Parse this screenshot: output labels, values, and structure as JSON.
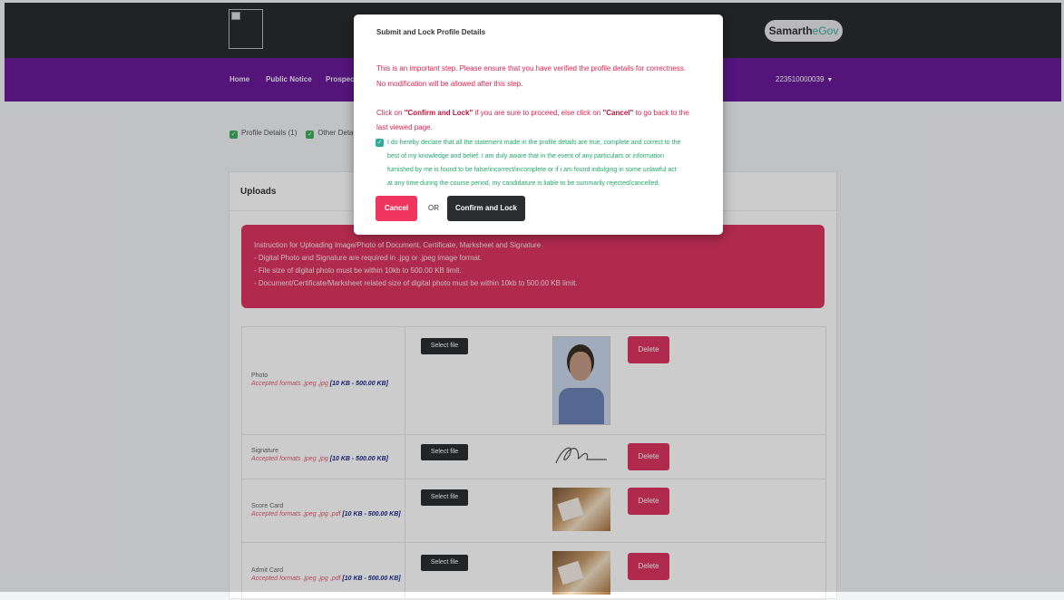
{
  "header": {
    "brand_main": "Samarth",
    "brand_sub": "eGov"
  },
  "nav": {
    "home": "Home",
    "public_notice": "Public Notice",
    "prospectus": "Prospect",
    "user_id": "223510000039"
  },
  "progress": {
    "profile_details": "Profile Details (1)",
    "other_details": "Other Deta"
  },
  "uploads": {
    "title": "Uploads",
    "instructions": [
      "Instruction for Uploading Image/Photo of Document, Certificate, Marksheet and Signature",
      "- Digital Photo and Signature are required in .jpg or .jpeg image format.",
      "- File size of digital photo must be within 10kb to 500.00 KB limit.",
      "- Document/Certificate/Marksheet related size of digital photo must be within 10kb to 500.00 KB limit."
    ],
    "rows": [
      {
        "label": "Photo",
        "formats": "Accepted formats .jpeg ,jpg",
        "size": "[10 KB - 500.00 KB]",
        "select": "Select file",
        "delete": "Delete"
      },
      {
        "label": "Signature",
        "formats": "Accepted formats .jpeg ,jpg",
        "size": "[10 KB - 500.00 KB]",
        "select": "Select file",
        "delete": "Delete"
      },
      {
        "label": "Score Card",
        "formats": "Accepted formats .jpeg ,jpg ,pdf",
        "size": "[10 KB - 500.00 KB]",
        "select": "Select file",
        "delete": "Delete"
      },
      {
        "label": "Admit Card",
        "formats": "Accepted formats .jpeg ,jpg ,pdf",
        "size": "[10 KB - 500.00 KB]",
        "select": "Select file",
        "delete": "Delete"
      }
    ]
  },
  "modal": {
    "title": "Submit and Lock Profile Details",
    "warning_line1": "This is an important step. Please ensure that you have verified the profile details for correctness.",
    "warning_line2": "No modification will be allowed after this step.",
    "click_on": "Click on ",
    "confirm_quoted": "\"Confirm and Lock\"",
    "mid_text": " if you are sure to proceed, else click on ",
    "cancel_quoted": "\"Cancel\"",
    "end_text": " to go back to the",
    "last_line": "last viewed page.",
    "declaration": [
      "I do hereby declare that all the statement made in the profile details are true, complete and correct to the",
      "best of my knowledge and belief. I am duly aware that in the event of any particulars or information",
      "furnished by me is found to be false/incorrect/incomplete or if i am found indulging in some unlawful act",
      "at any time during the course period, my candidature is liable to be summarily rejected/cancelled."
    ],
    "cancel_label": "Cancel",
    "or_label": "OR",
    "confirm_label": "Confirm and Lock"
  }
}
